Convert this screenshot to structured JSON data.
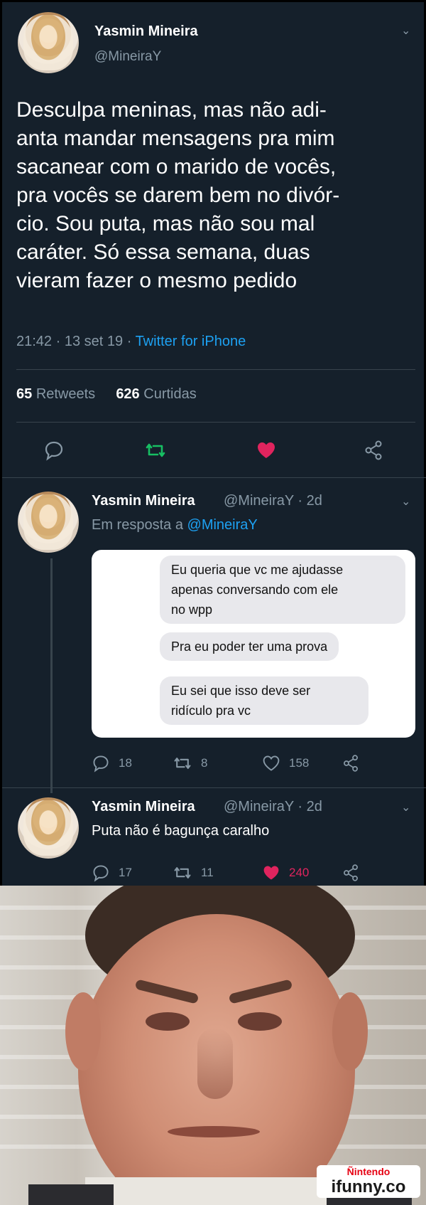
{
  "tweet": {
    "author_name": "Yasmin Mineira",
    "author_handle": "@MineiraY",
    "text": "Desculpa meninas, mas não adi-\nanta mandar mensagens pra mim\nsacanear com o marido de vocês,\npra vocês se darem bem no divór-\ncio. Sou puta, mas não sou mal\ncaráter. Só essa semana, duas\nvieram fazer o mesmo pedido",
    "time": "21:42",
    "date": "13 set 19",
    "source": "Twitter for iPhone",
    "retweets_count": "65",
    "retweets_label": "Retweets",
    "likes_count": "626",
    "likes_label": "Curtidas",
    "colors": {
      "background": "#15202b",
      "link": "#1da1f2",
      "retweet": "#17bf63",
      "like": "#e0245e"
    }
  },
  "reply1": {
    "author_name": "Yasmin Mineira",
    "handle_time": "@MineiraY · 2d",
    "in_reply_prefix": "Em resposta a",
    "in_reply_handle": "@MineiraY",
    "bubbles": [
      "Eu queria que vc me ajudasse\napenas conversando com ele\nno wpp",
      "Pra eu poder ter uma prova",
      "Eu sei que isso deve ser\nridículo pra vc"
    ],
    "replies": "18",
    "retweets": "8",
    "likes": "158"
  },
  "reply2": {
    "author_name": "Yasmin Mineira",
    "handle_time": "@MineiraY · 2d",
    "text": "Puta não é bagunça caralho",
    "replies": "17",
    "retweets": "11",
    "likes": "240"
  },
  "watermark": {
    "line1": "Ñintendo",
    "line2": "ifunny.co"
  }
}
